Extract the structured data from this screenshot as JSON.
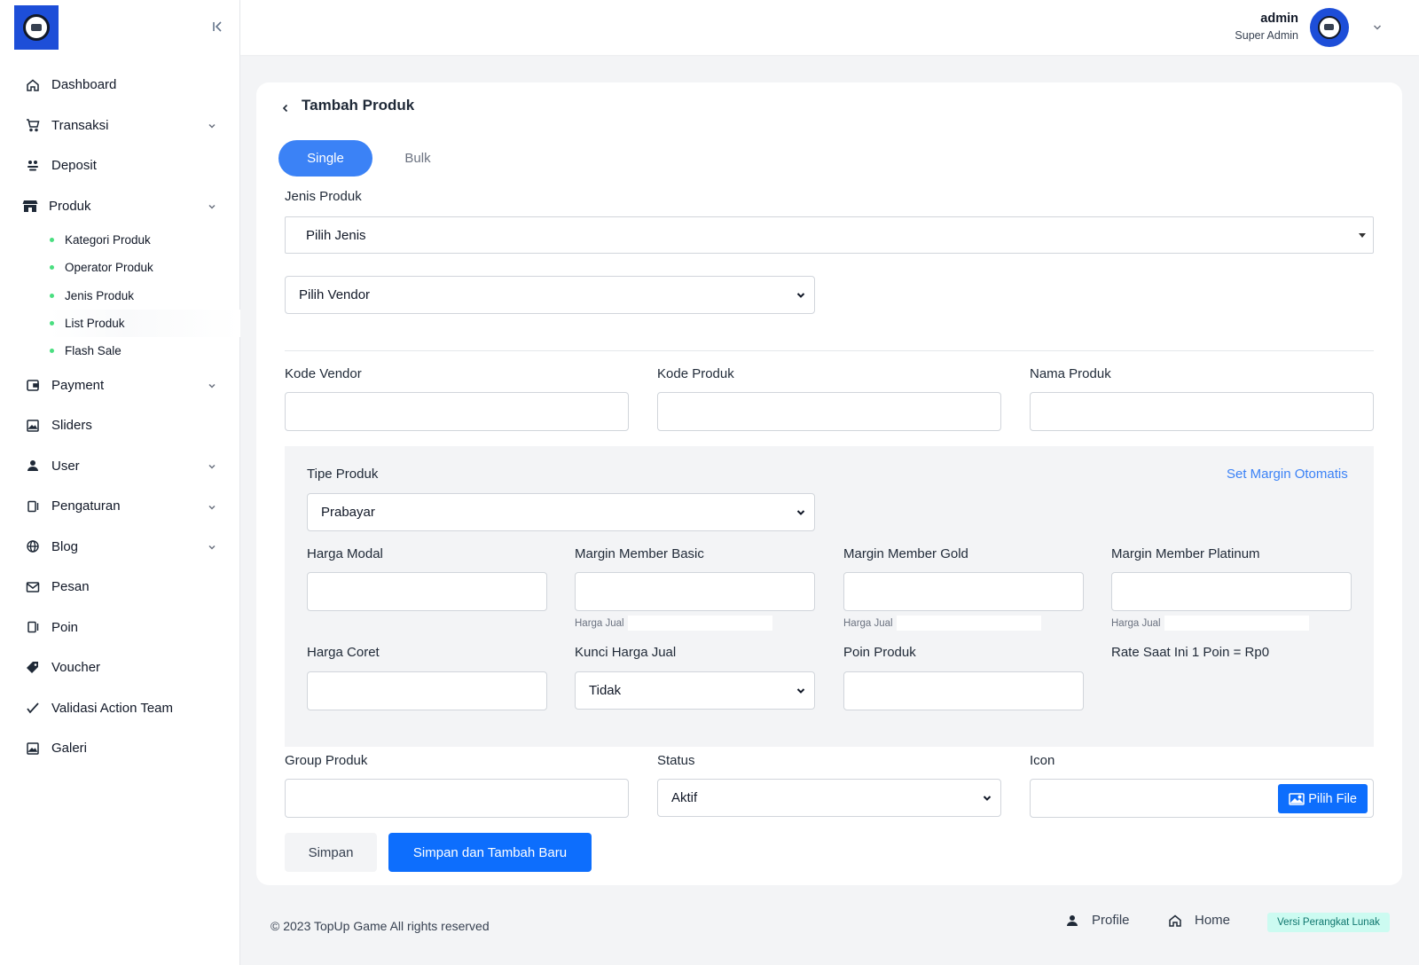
{
  "sidebar": {
    "items": [
      {
        "label": "Dashboard",
        "icon": "home-icon"
      },
      {
        "label": "Transaksi",
        "icon": "cart-icon"
      },
      {
        "label": "Deposit",
        "icon": "deposit-icon"
      },
      {
        "label": "Produk",
        "icon": "store-icon"
      },
      {
        "label": "Payment",
        "icon": "wallet-icon"
      },
      {
        "label": "Sliders",
        "icon": "image-icon"
      },
      {
        "label": "User",
        "icon": "user-icon"
      },
      {
        "label": "Pengaturan",
        "icon": "settings-icon"
      },
      {
        "label": "Blog",
        "icon": "globe-icon"
      },
      {
        "label": "Pesan",
        "icon": "mail-icon"
      },
      {
        "label": "Poin",
        "icon": "points-icon"
      },
      {
        "label": "Voucher",
        "icon": "tag-icon"
      },
      {
        "label": "Validasi Action Team",
        "icon": "check-icon"
      },
      {
        "label": "Galeri",
        "icon": "gallery-icon"
      }
    ],
    "produk_sub": [
      "Kategori Produk",
      "Operator Produk",
      "Jenis Produk",
      "List Produk",
      "Flash Sale"
    ]
  },
  "topbar": {
    "user_name": "admin",
    "user_role": "Super Admin"
  },
  "page": {
    "title": "Tambah Produk",
    "tabs": {
      "single": "Single",
      "bulk": "Bulk"
    },
    "jenis_produk": {
      "label": "Jenis Produk",
      "placeholder": "Pilih Jenis"
    },
    "vendor": {
      "value": "Pilih Vendor"
    },
    "kode_vendor": {
      "label": "Kode Vendor"
    },
    "kode_produk": {
      "label": "Kode Produk"
    },
    "nama_produk": {
      "label": "Nama Produk"
    },
    "tipe_produk": {
      "label": "Tipe Produk",
      "value": "Prabayar"
    },
    "set_margin": "Set Margin Otomatis",
    "harga_modal": {
      "label": "Harga Modal"
    },
    "margin_basic": {
      "label": "Margin Member Basic"
    },
    "margin_gold": {
      "label": "Margin Member Gold"
    },
    "margin_platinum": {
      "label": "Margin Member Platinum"
    },
    "harga_jual_label": "Harga Jual",
    "harga_coret": {
      "label": "Harga Coret"
    },
    "kunci_harga": {
      "label": "Kunci Harga Jual",
      "value": "Tidak"
    },
    "poin_produk": {
      "label": "Poin Produk"
    },
    "rate": "Rate Saat Ini 1 Poin = Rp0",
    "group_produk": {
      "label": "Group Produk"
    },
    "status": {
      "label": "Status",
      "value": "Aktif"
    },
    "icon": {
      "label": "Icon",
      "button": "Pilih File"
    },
    "buttons": {
      "save": "Simpan",
      "save_new": "Simpan dan Tambah Baru"
    }
  },
  "footer": {
    "copyright": "© 2023 TopUp Game All rights reserved",
    "profile": "Profile",
    "home": "Home",
    "version": "Versi Perangkat Lunak"
  },
  "colors": {
    "primary": "#0d6efd",
    "tab_active": "#3b82f6",
    "link": "#3b82f6",
    "bullet": "#4ade80",
    "logo_bg": "#1d4ed8"
  }
}
